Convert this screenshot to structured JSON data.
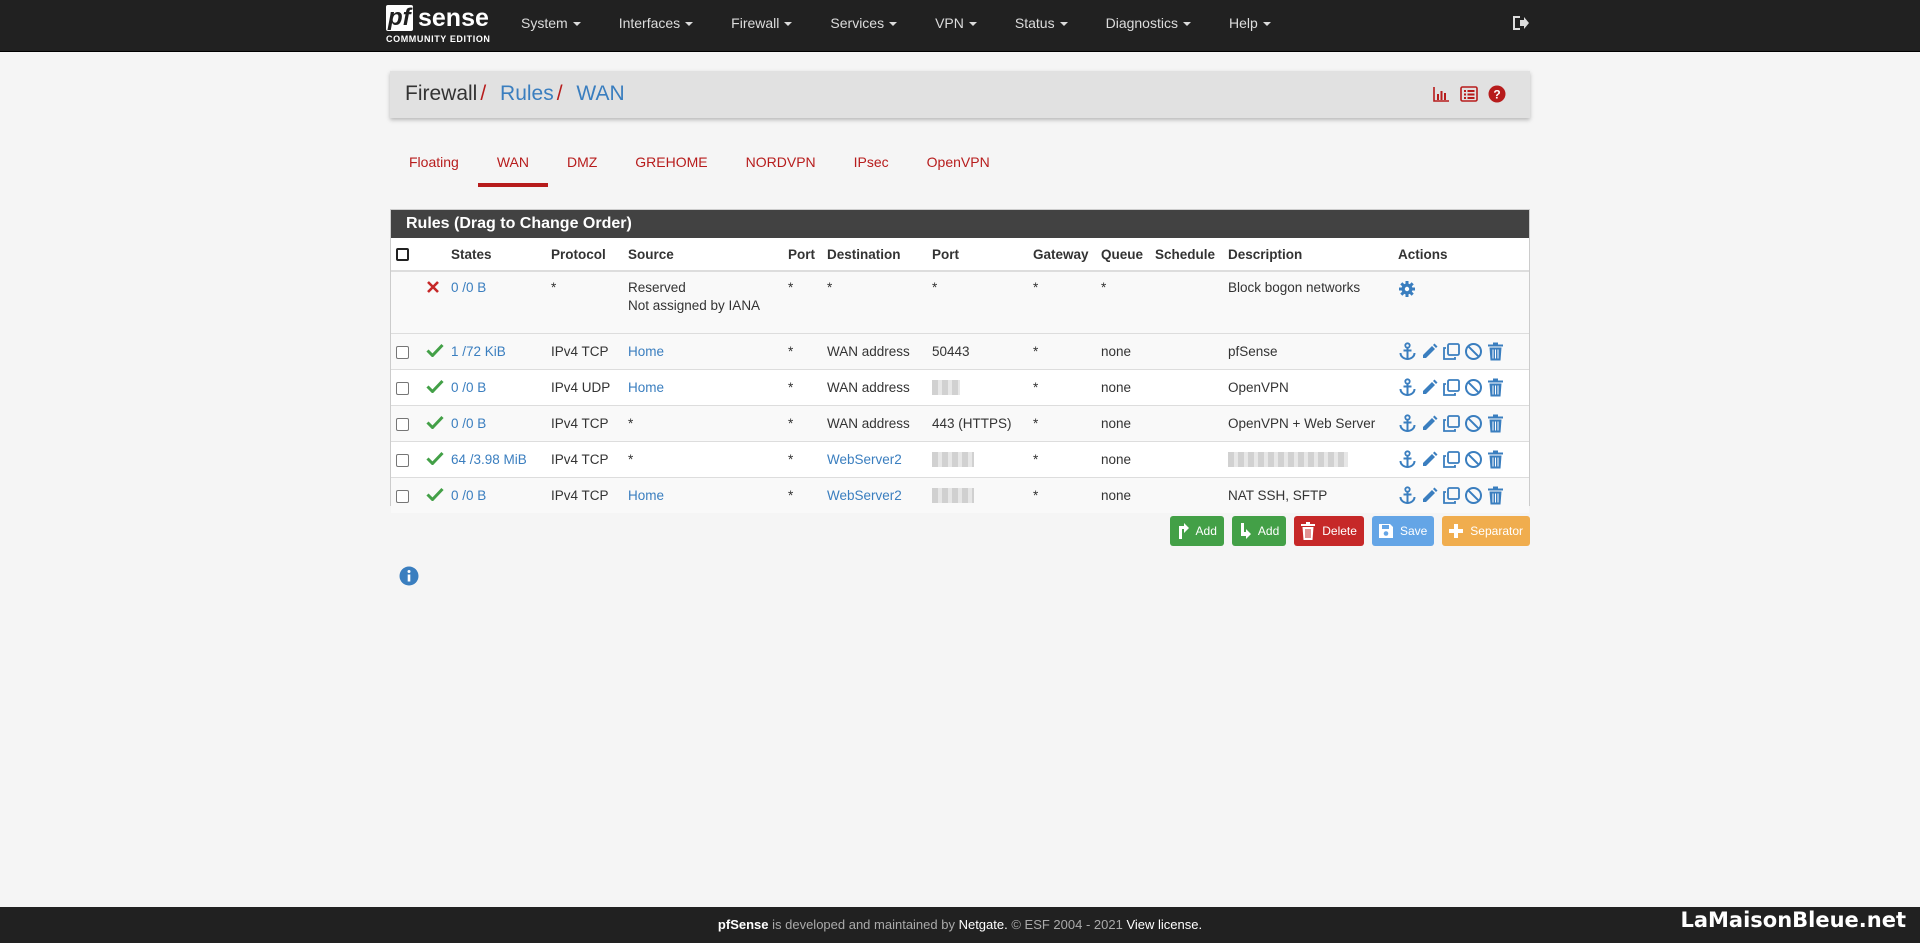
{
  "brand": {
    "pf": "pf",
    "sense": "sense",
    "edition": "COMMUNITY EDITION"
  },
  "nav": {
    "items": [
      "System",
      "Interfaces",
      "Firewall",
      "Services",
      "VPN",
      "Status",
      "Diagnostics",
      "Help"
    ]
  },
  "breadcrumb": {
    "level1": "Firewall",
    "level2": "Rules",
    "level3": "WAN",
    "separator": "/"
  },
  "tabs": [
    "Floating",
    "WAN",
    "DMZ",
    "GREHOME",
    "NORDVPN",
    "IPsec",
    "OpenVPN"
  ],
  "active_tab": "WAN",
  "panel": {
    "title": "Rules (Drag to Change Order)"
  },
  "table": {
    "headers": [
      "States",
      "Protocol",
      "Source",
      "Port",
      "Destination",
      "Port",
      "Gateway",
      "Queue",
      "Schedule",
      "Description",
      "Actions"
    ],
    "bogon_row": {
      "states": "0 /0 B",
      "protocol": "*",
      "source_line1": "Reserved",
      "source_line2": "Not assigned by IANA",
      "src_port": "*",
      "destination": "*",
      "dst_port": "*",
      "gateway": "*",
      "queue": "*",
      "schedule": "",
      "description": "Block bogon networks"
    },
    "rows": [
      {
        "states": "1 /72 KiB",
        "protocol": "IPv4 TCP",
        "source": "Home",
        "src_port": "*",
        "destination": "WAN address",
        "dst_port": "50443",
        "gateway": "*",
        "queue": "none",
        "description": "pfSense"
      },
      {
        "states": "0 /0 B",
        "protocol": "IPv4 UDP",
        "source": "Home",
        "src_port": "*",
        "destination": "WAN address",
        "dst_port": "",
        "gateway": "*",
        "queue": "none",
        "description": "OpenVPN"
      },
      {
        "states": "0 /0 B",
        "protocol": "IPv4 TCP",
        "source": "*",
        "src_port": "*",
        "destination": "WAN address",
        "dst_port": "443 (HTTPS)",
        "gateway": "*",
        "queue": "none",
        "description": "OpenVPN + Web Server"
      },
      {
        "states": "64 /3.98 MiB",
        "protocol": "IPv4 TCP",
        "source": "*",
        "src_port": "*",
        "destination": "WebServer2",
        "dst_port": "",
        "gateway": "*",
        "queue": "none",
        "description": ""
      },
      {
        "states": "0 /0 B",
        "protocol": "IPv4 TCP",
        "source": "Home",
        "src_port": "*",
        "destination": "WebServer2",
        "dst_port": "",
        "gateway": "*",
        "queue": "none",
        "description": "NAT SSH, SFTP"
      }
    ]
  },
  "buttons": {
    "add_top": "Add",
    "add_bottom": "Add",
    "delete": "Delete",
    "save": "Save",
    "separator": "Separator"
  },
  "footer": {
    "product": "pfSense",
    "text1": " is developed and maintained by ",
    "company": "Netgate.",
    "text2": " © ESF 2004 - 2021 ",
    "license": "View license."
  },
  "watermark": "LaMaisonBleue.net",
  "colors": {
    "navbar": "#212121",
    "accent_red": "#b71c1c",
    "link_blue": "#3a7ebf",
    "pass_green": "#43a047",
    "panel_heading": "#424242"
  }
}
